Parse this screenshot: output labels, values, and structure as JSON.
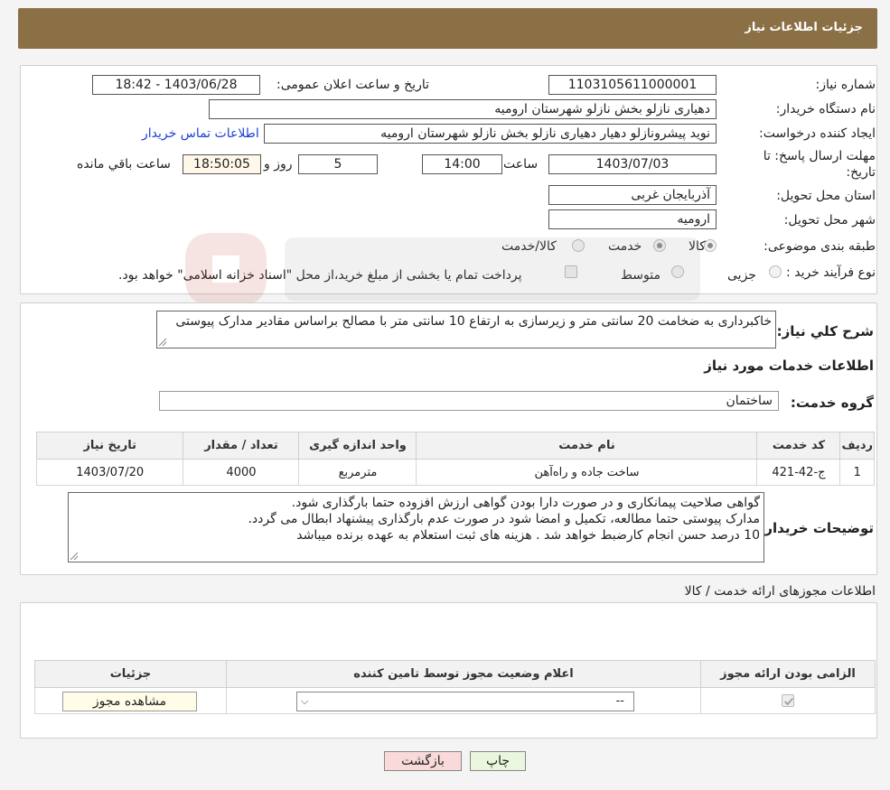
{
  "header": {
    "title": "جزئیات اطلاعات نیاز"
  },
  "details": {
    "need_number_label": "شماره نیاز:",
    "need_number": "1103105611000001",
    "announce_label": "تاریخ و ساعت اعلان عمومی:",
    "announce_value": "1403/06/28 - 18:42",
    "buyer_org_label": "نام دستگاه خریدار:",
    "buyer_org": "دهیاری نازلو بخش نازلو شهرستان ارومیه",
    "requester_label": "ایجاد کننده درخواست:",
    "requester": "نوید پیشرونازلو دهیار دهیاری نازلو بخش نازلو شهرستان ارومیه",
    "contact_link": "اطلاعات تماس خریدار",
    "deadline_label_1": "مهلت ارسال پاسخ: تا",
    "deadline_label_2": "تاریخ:",
    "deadline_date": "1403/07/03",
    "time_label": "ساعت",
    "deadline_time": "14:00",
    "days_value": "5",
    "days_label": "روز و",
    "remaining_time": "18:50:05",
    "remaining_label": "ساعت باقي مانده",
    "province_label": "استان محل تحویل:",
    "province": "آذربایجان غربی",
    "city_label": "شهر محل تحویل:",
    "city": "ارومیه",
    "category_label": "طبقه بندی موضوعی:",
    "category_options": [
      "کالا",
      "خدمت",
      "کالا/خدمت"
    ],
    "purchase_type_label": "نوع فرآیند خرید :",
    "purchase_options": [
      "جزیی",
      "متوسط"
    ],
    "payment_note": "پرداخت تمام یا بخشی از مبلغ خرید،از محل \"اسناد خزانه اسلامی\" خواهد بود."
  },
  "summary": {
    "label": "شرح کلي نياز:",
    "text": "خاکبرداری به ضخامت 20 سانتی متر و زیرسازی به ارتفاع 10 سانتی متر با مصالح براساس مقادیر مدارک پیوستی",
    "services_heading": "اطلاعات خدمات مورد نياز",
    "service_group_label": "گروه خدمت:",
    "service_group": "ساختمان"
  },
  "services_table": {
    "headers": [
      "ردیف",
      "کد خدمت",
      "نام خدمت",
      "واحد اندازه گیری",
      "تعداد / مقدار",
      "تاریخ نیاز"
    ],
    "rows": [
      [
        "1",
        "ج-42-421",
        "ساخت جاده و راه‌آهن",
        "مترمربع",
        "4000",
        "1403/07/20"
      ]
    ]
  },
  "buyer_notes": {
    "label": "توضیحات خریدار:",
    "lines": [
      "گواهی صلاحیت پیمانکاری و در صورت دارا بودن گواهی ارزش افزوده حتما بارگذاری شود.",
      "مدارک پیوستی حتما مطالعه، تکمیل و امضا شود در صورت عدم بارگذاری پیشنهاد ابطال می گردد.",
      "10 درصد حسن انجام کارضبط خواهد شد . هزینه های ثبت استعلام به عهده برنده میباشد"
    ]
  },
  "permits": {
    "title": "اطلاعات مجوزهای ارائه خدمت / کالا",
    "headers": [
      "الزامی بودن ارائه مجوز",
      "اعلام وضعیت مجوز توسط تامین کننده",
      "جزئیات"
    ],
    "select_value": "--",
    "view_button": "مشاهده مجوز"
  },
  "actions": {
    "print": "چاپ",
    "back": "بازگشت"
  },
  "colors": {
    "header": "#8b6f45",
    "link": "#1a3fd6",
    "back_button": "#f7d6d6",
    "print_button": "#e8f5d9"
  }
}
